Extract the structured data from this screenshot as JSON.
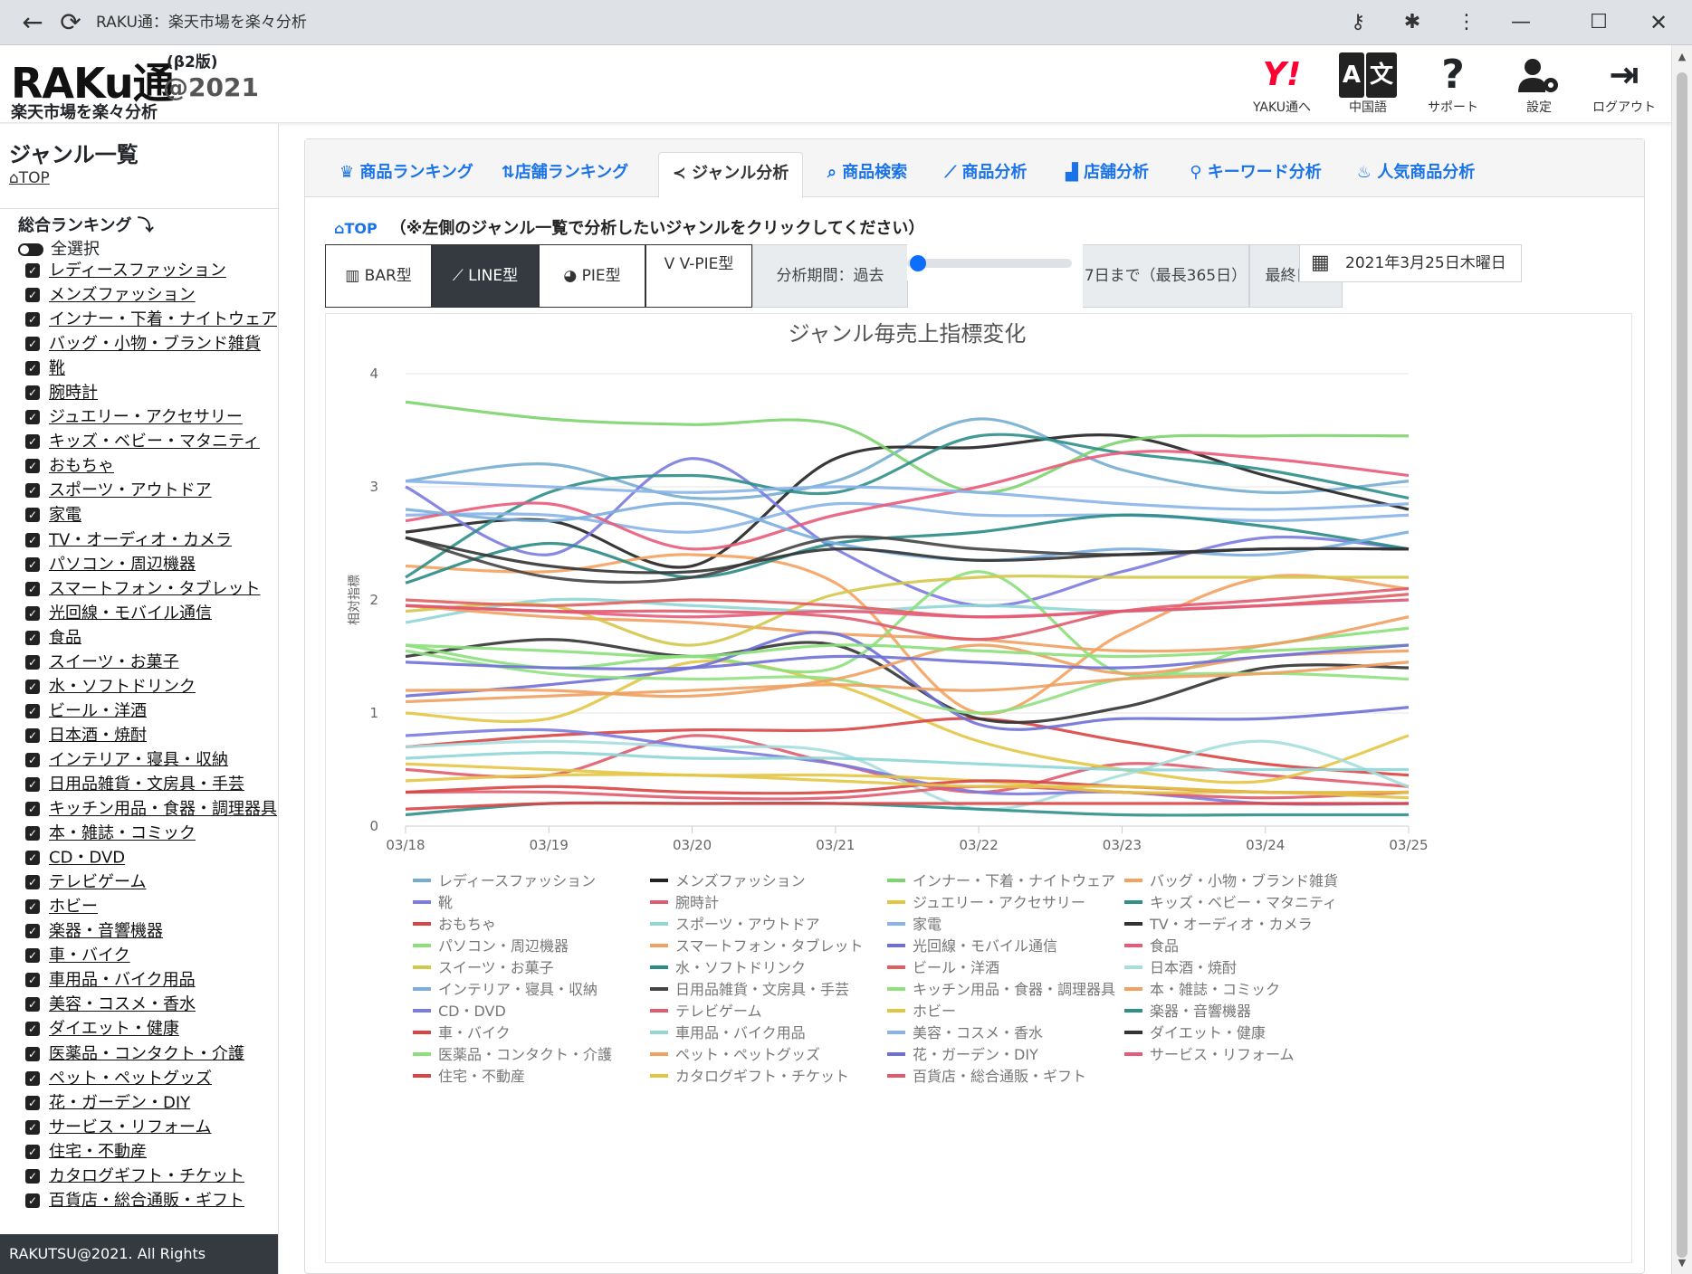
{
  "browser": {
    "title": "RAKU通：楽天市場を楽々分析"
  },
  "header": {
    "logo_main": "RAKu通",
    "logo_beta": "(β2版)",
    "logo_year": "@2021",
    "logo_sub": "楽天市場を楽々分析",
    "actions": [
      {
        "label": "YAKU通へ",
        "glyph": "Y!",
        "icon": "yahoo-icon",
        "color": "#ff0033"
      },
      {
        "label": "中国語",
        "glyph": "文",
        "icon": "translate-icon",
        "color": "#222222"
      },
      {
        "label": "サポート",
        "glyph": "?",
        "icon": "question-icon",
        "color": "#222222"
      },
      {
        "label": "設定",
        "glyph": "⚙",
        "icon": "user-gear-icon",
        "color": "#222222"
      },
      {
        "label": "ログアウト",
        "glyph": "⇥",
        "icon": "logout-icon",
        "color": "#222222"
      }
    ]
  },
  "sidebar": {
    "title": "ジャンル一覧",
    "top_link": "TOP",
    "ranking_label": "総合ランキング ⤵",
    "select_all": "全選択",
    "genres": [
      "レディースファッション",
      "メンズファッション",
      "インナー・下着・ナイトウェア",
      "バッグ・小物・ブランド雑貨",
      "靴",
      "腕時計",
      "ジュエリー・アクセサリー",
      "キッズ・ベビー・マタニティ",
      "おもちゃ",
      "スポーツ・アウトドア",
      "家電",
      "TV・オーディオ・カメラ",
      "パソコン・周辺機器",
      "スマートフォン・タブレット",
      "光回線・モバイル通信",
      "食品",
      "スイーツ・お菓子",
      "水・ソフトドリンク",
      "ビール・洋酒",
      "日本酒・焼酎",
      "インテリア・寝具・収納",
      "日用品雑貨・文房具・手芸",
      "キッチン用品・食器・調理器具",
      "本・雑誌・コミック",
      "CD・DVD",
      "テレビゲーム",
      "ホビー",
      "楽器・音響機器",
      "車・バイク",
      "車用品・バイク用品",
      "美容・コスメ・香水",
      "ダイエット・健康",
      "医薬品・コンタクト・介護",
      "ペット・ペットグッズ",
      "花・ガーデン・DIY",
      "サービス・リフォーム",
      "住宅・不動産",
      "カタログギフト・チケット",
      "百貨店・総合通販・ギフト"
    ],
    "footer": "RAKUTSU@2021. All Rights Reserved."
  },
  "tabs": [
    {
      "label": "商品ランキング",
      "icon": "crown-icon",
      "glyph": "♛"
    },
    {
      "label": "店舗ランキング",
      "icon": "sort-icon",
      "glyph": "⇅"
    },
    {
      "label": "ジャンル分析",
      "icon": "share-icon",
      "glyph": "≺"
    },
    {
      "label": "商品検索",
      "icon": "search-icon",
      "glyph": "⌕"
    },
    {
      "label": "商品分析",
      "icon": "line-chart-icon",
      "glyph": "⟋"
    },
    {
      "label": "店舗分析",
      "icon": "area-chart-icon",
      "glyph": "▟"
    },
    {
      "label": "キーワード分析",
      "icon": "keyword-icon",
      "glyph": "⚲"
    },
    {
      "label": "人気商品分析",
      "icon": "fire-icon",
      "glyph": "♨"
    }
  ],
  "crumb": {
    "home": "TOP",
    "note": "（※左側のジャンル一覧で分析したいジャンルをクリックしてください）"
  },
  "toolbar": {
    "bar": "BAR型",
    "line": "LINE型",
    "pie": "PIE型",
    "vpie": "V-PIE型",
    "period_label": "分析期間：過去",
    "period_value": "7日まで（最長365日）",
    "slider_value": 7,
    "slider_max": 365,
    "last_day_label": "最終日：",
    "last_day_value": "2021年3月25日木曜日"
  },
  "chart_data": {
    "type": "line",
    "title": "ジャンル毎売上指標変化",
    "ylabel": "相対指標",
    "xlabel": "",
    "x": [
      "03/18",
      "03/19",
      "03/20",
      "03/21",
      "03/22",
      "03/23",
      "03/24",
      "03/25"
    ],
    "ylim": [
      0,
      4
    ],
    "yticks": [
      0,
      1,
      2,
      3,
      4
    ],
    "grid": true,
    "legend_position": "bottom",
    "series": [
      {
        "name": "レディースファッション",
        "color": "#74add1",
        "values": [
          3.05,
          3.2,
          2.9,
          3.05,
          3.6,
          3.15,
          2.95,
          3.05
        ]
      },
      {
        "name": "メンズファッション",
        "color": "#222222",
        "values": [
          2.6,
          2.7,
          2.3,
          3.25,
          3.35,
          3.45,
          3.1,
          2.8
        ]
      },
      {
        "name": "インナー・下着・ナイトウェア",
        "color": "#7cd46e",
        "values": [
          3.75,
          3.6,
          3.55,
          3.55,
          2.95,
          3.4,
          3.45,
          3.45
        ]
      },
      {
        "name": "バッグ・小物・ブランド雑貨",
        "color": "#f4a261",
        "values": [
          2.3,
          2.25,
          2.4,
          2.15,
          1.0,
          1.7,
          2.2,
          2.1
        ]
      },
      {
        "name": "靴",
        "color": "#7b7be0",
        "values": [
          3.0,
          2.4,
          3.25,
          2.45,
          1.95,
          2.25,
          2.55,
          2.45
        ]
      },
      {
        "name": "腕時計",
        "color": "#e05b6e",
        "values": [
          0.5,
          0.45,
          0.8,
          0.55,
          0.3,
          0.55,
          0.45,
          0.35
        ]
      },
      {
        "name": "ジュエリー・アクセサリー",
        "color": "#e3c545",
        "values": [
          1.0,
          0.95,
          1.45,
          1.25,
          0.75,
          0.5,
          0.4,
          0.8
        ]
      },
      {
        "name": "キッズ・ベビー・マタニティ",
        "color": "#2f8f8a",
        "values": [
          2.2,
          2.95,
          3.1,
          2.95,
          3.45,
          3.3,
          3.15,
          2.9
        ]
      },
      {
        "name": "おもちゃ",
        "color": "#d94545",
        "values": [
          0.7,
          0.8,
          0.85,
          0.85,
          0.95,
          0.75,
          0.55,
          0.45
        ]
      },
      {
        "name": "スポーツ・アウトドア",
        "color": "#8fd6d6",
        "values": [
          1.8,
          2.0,
          1.95,
          1.9,
          1.95,
          1.9,
          1.95,
          2.0
        ]
      },
      {
        "name": "家電",
        "color": "#8ab4e8",
        "values": [
          2.75,
          2.75,
          2.6,
          2.85,
          2.75,
          2.75,
          2.7,
          2.75
        ]
      },
      {
        "name": "TV・オーディオ・カメラ",
        "color": "#333333",
        "values": [
          1.5,
          1.65,
          1.5,
          1.6,
          0.95,
          1.05,
          1.4,
          1.4
        ]
      },
      {
        "name": "パソコン・周辺機器",
        "color": "#8be07a",
        "values": [
          1.6,
          1.4,
          1.5,
          1.4,
          2.25,
          1.35,
          1.6,
          1.75
        ]
      },
      {
        "name": "スマートフォン・タブレット",
        "color": "#f0a060",
        "values": [
          1.95,
          1.85,
          1.8,
          1.7,
          1.65,
          1.55,
          1.6,
          1.85
        ]
      },
      {
        "name": "光回線・モバイル通信",
        "color": "#6f6fd8",
        "values": [
          1.15,
          1.25,
          1.4,
          1.7,
          0.9,
          0.95,
          0.95,
          1.05
        ]
      },
      {
        "name": "食品",
        "color": "#e85a7a",
        "values": [
          2.7,
          2.85,
          2.45,
          2.75,
          3.0,
          3.3,
          3.25,
          3.1
        ]
      },
      {
        "name": "スイーツ・お菓子",
        "color": "#d4c84a",
        "values": [
          1.9,
          1.95,
          1.6,
          2.05,
          2.2,
          2.2,
          2.2,
          2.2
        ]
      },
      {
        "name": "水・ソフトドリンク",
        "color": "#2a8a85",
        "values": [
          2.15,
          2.5,
          2.2,
          2.5,
          2.6,
          2.75,
          2.65,
          2.45
        ]
      },
      {
        "name": "ビール・洋酒",
        "color": "#e06060",
        "values": [
          2.0,
          1.95,
          2.0,
          1.95,
          1.85,
          1.9,
          1.95,
          2.05
        ]
      },
      {
        "name": "日本酒・焼酎",
        "color": "#a6dede",
        "values": [
          0.7,
          0.75,
          0.7,
          0.65,
          0.15,
          0.45,
          0.75,
          0.35
        ]
      },
      {
        "name": "インテリア・寝具・収納",
        "color": "#7aaee0",
        "values": [
          2.8,
          2.7,
          2.85,
          2.5,
          2.35,
          2.45,
          2.4,
          2.6
        ]
      },
      {
        "name": "日用品雑貨・文房具・手芸",
        "color": "#444444",
        "values": [
          2.55,
          2.2,
          2.2,
          2.55,
          2.45,
          2.4,
          2.45,
          2.45
        ]
      },
      {
        "name": "キッチン用品・食器・調理器具",
        "color": "#90e080",
        "values": [
          1.55,
          1.35,
          1.3,
          1.3,
          1.0,
          1.3,
          1.35,
          1.3
        ]
      },
      {
        "name": "本・雑誌・コミック",
        "color": "#f0a060",
        "values": [
          1.2,
          1.2,
          1.15,
          1.3,
          1.6,
          1.35,
          1.5,
          1.55
        ]
      },
      {
        "name": "CD・DVD",
        "color": "#7b7be0",
        "values": [
          0.8,
          0.85,
          0.7,
          0.55,
          0.3,
          0.3,
          0.2,
          0.2
        ]
      },
      {
        "name": "テレビゲーム",
        "color": "#e05b6e",
        "values": [
          0.3,
          0.3,
          0.25,
          0.25,
          0.35,
          0.3,
          0.25,
          0.3
        ]
      },
      {
        "name": "ホビー",
        "color": "#e3c545",
        "values": [
          0.55,
          0.5,
          0.45,
          0.45,
          0.4,
          0.3,
          0.3,
          0.25
        ]
      },
      {
        "name": "楽器・音響機器",
        "color": "#2f8f8a",
        "values": [
          0.1,
          0.2,
          0.2,
          0.2,
          0.15,
          0.1,
          0.1,
          0.1
        ]
      },
      {
        "name": "車・バイク",
        "color": "#d94545",
        "values": [
          0.3,
          0.35,
          0.3,
          0.3,
          0.4,
          0.35,
          0.3,
          0.3
        ]
      },
      {
        "name": "車用品・バイク用品",
        "color": "#8fd6d6",
        "values": [
          0.6,
          0.65,
          0.6,
          0.6,
          0.55,
          0.5,
          0.5,
          0.5
        ]
      },
      {
        "name": "美容・コスメ・香水",
        "color": "#8ab4e8",
        "values": [
          3.05,
          3.0,
          2.95,
          3.0,
          2.95,
          2.85,
          2.8,
          2.85
        ]
      },
      {
        "name": "ダイエット・健康",
        "color": "#333333",
        "values": [
          2.55,
          2.3,
          2.25,
          2.45,
          2.35,
          2.4,
          2.45,
          2.45
        ]
      },
      {
        "name": "医薬品・コンタクト・介護",
        "color": "#8be07a",
        "values": [
          1.6,
          1.55,
          1.5,
          1.6,
          1.55,
          1.5,
          1.55,
          1.6
        ]
      },
      {
        "name": "ペット・ペットグッズ",
        "color": "#f0a060",
        "values": [
          1.1,
          1.15,
          1.2,
          1.25,
          1.2,
          1.3,
          1.35,
          1.45
        ]
      },
      {
        "name": "花・ガーデン・DIY",
        "color": "#6f6fd8",
        "values": [
          1.45,
          1.4,
          1.4,
          1.5,
          1.45,
          1.4,
          1.5,
          1.6
        ]
      },
      {
        "name": "サービス・リフォーム",
        "color": "#e85a7a",
        "values": [
          1.95,
          1.9,
          1.85,
          1.9,
          1.85,
          1.9,
          1.95,
          2.0
        ]
      },
      {
        "name": "住宅・不動産",
        "color": "#d94545",
        "values": [
          0.15,
          0.2,
          0.2,
          0.2,
          0.2,
          0.2,
          0.2,
          0.2
        ]
      },
      {
        "name": "カタログギフト・チケット",
        "color": "#e3c545",
        "values": [
          0.4,
          0.45,
          0.45,
          0.4,
          0.35,
          0.35,
          0.3,
          0.3
        ]
      },
      {
        "name": "百貨店・総合通販・ギフト",
        "color": "#e05b6e",
        "values": [
          1.95,
          1.9,
          1.9,
          1.85,
          1.65,
          1.9,
          2.0,
          2.1
        ]
      }
    ]
  }
}
